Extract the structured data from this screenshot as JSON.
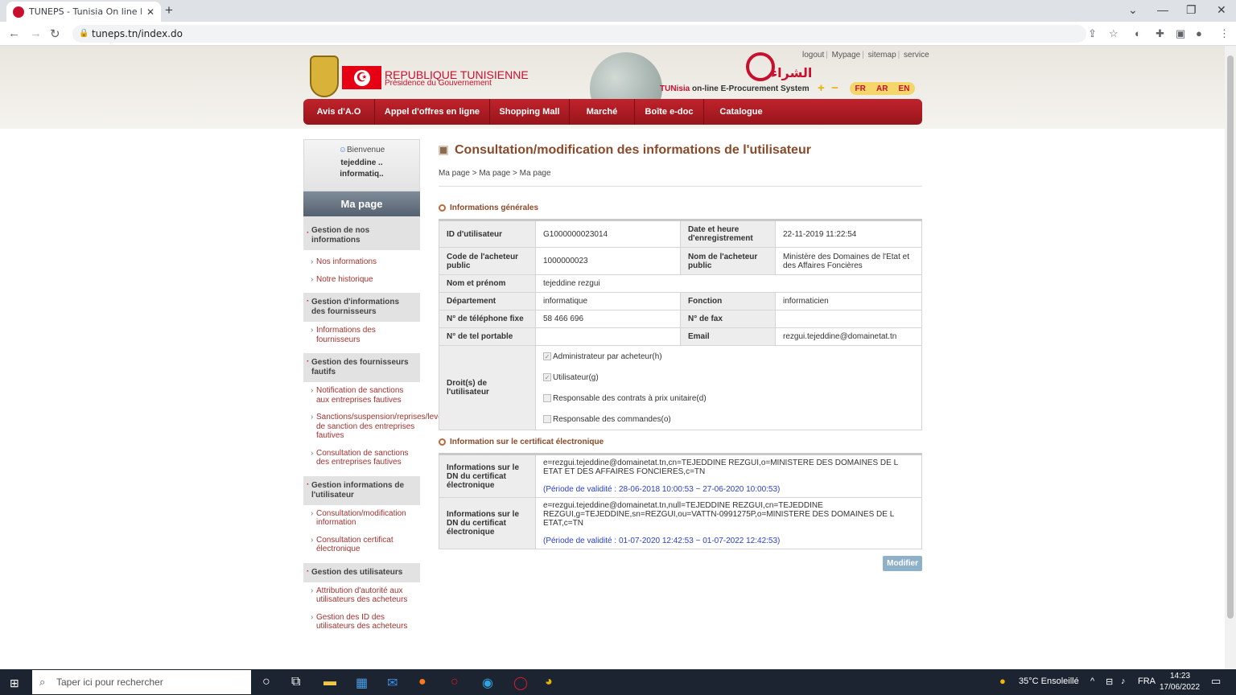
{
  "browser": {
    "tab_title": "TUNEPS - Tunisia On line E-Proc",
    "tab_close": "✕",
    "new_tab": "+",
    "url": "tuneps.tn/index.do",
    "win_min": "—",
    "win_restore": "❐",
    "win_close": "✕",
    "win_chevron": "⌄"
  },
  "header": {
    "republique": "REPUBLIQUE TUNISIENNE",
    "presidence": "Présidence du Gouvernement",
    "arabic_logo": "الشراء",
    "tagline_tun": "TUNisia",
    "tagline_rest": " on-line E-Procurement System",
    "top_links": [
      "logout",
      "Mypage",
      "sitemap",
      "service"
    ],
    "zoom_in": "+",
    "zoom_out": "−",
    "langs": [
      "FR",
      "AR",
      "EN"
    ]
  },
  "nav": [
    "Avis d'A.O",
    "Appel d'offres en ligne",
    "Shopping Mall",
    "Marché",
    "Boîte e-doc",
    "Catalogue"
  ],
  "sidebar": {
    "welcome": "Bienvenue",
    "user_line1": "tejeddine ..",
    "user_line2": "informatiq..",
    "my_page": "Ma page",
    "groups": [
      {
        "title": "Gestion de nos informations",
        "items": [
          "Nos informations",
          "Notre historique"
        ]
      },
      {
        "title": "Gestion d'informations des fournisseurs",
        "items": [
          "Informations des fournisseurs"
        ]
      },
      {
        "title": "Gestion des fournisseurs fautifs",
        "items": [
          "Notification de sanctions aux entreprises fautives",
          "Sanctions/suspension/reprises/levées de sanction des entreprises fautives",
          "Consultation de sanctions des entreprises fautives"
        ]
      },
      {
        "title": "Gestion informations de l'utilisateur",
        "items": [
          "Consultation/modification information",
          "Consultation certificat électronique"
        ]
      },
      {
        "title": "Gestion des utilisateurs",
        "items": [
          "Attribution d'autorité aux utilisateurs des acheteurs",
          "Gestion des ID des utilisateurs des acheteurs"
        ]
      }
    ]
  },
  "main": {
    "title": "Consultation/modification des informations de l'utilisateur",
    "breadcrumb": "Ma page > Ma page > Ma page",
    "section_general": "Informations générales",
    "labels": {
      "user_id": "ID d'utilisateur",
      "reg_date": "Date et heure d'enregistrement",
      "buyer_code": "Code de l'acheteur public",
      "buyer_name": "Nom de l'acheteur public",
      "full_name": "Nom et prénom",
      "department": "Département",
      "function": "Fonction",
      "phone": "N° de téléphone fixe",
      "fax": "N° de fax",
      "mobile": "N° de tel portable",
      "email": "Email",
      "rights": "Droit(s) de l'utilisateur"
    },
    "values": {
      "user_id": "G1000000023014",
      "reg_date": "22-11-2019 11:22:54",
      "buyer_code": "1000000023",
      "buyer_name": "Ministère des Domaines de l'Etat et des Affaires Foncières",
      "full_name": "tejeddine rezgui",
      "department": "informatique",
      "function": "informaticien",
      "phone": "58 466 696",
      "fax": "",
      "mobile": "",
      "email": "rezgui.tejeddine@domainetat.tn"
    },
    "rights": [
      {
        "label": "Administrateur par acheteur(h)",
        "checked": true
      },
      {
        "label": "Utilisateur(g)",
        "checked": true
      },
      {
        "label": "Responsable des contrats à prix unitaire(d)",
        "checked": false
      },
      {
        "label": "Responsable des commandes(o)",
        "checked": false
      }
    ],
    "section_cert": "Information sur le certificat électronique",
    "cert_label": "Informations sur le DN du certificat électronique",
    "certs": [
      {
        "dn": "e=rezgui.tejeddine@domainetat.tn,cn=TEJEDDINE REZGUI,o=MINISTERE DES DOMAINES DE L ETAT ET DES AFFAIRES FONCIERES,c=TN",
        "validity": "(Période de validité : 28-06-2018 10:00:53 ~ 27-06-2020 10:00:53)"
      },
      {
        "dn": "e=rezgui.tejeddine@domainetat.tn,null=TEJEDDINE REZGUI,cn=TEJEDDINE REZGUI,g=TEJEDDINE,sn=REZGUI,ou=VATTN-0991275P,o=MINISTERE DES DOMAINES DE L ETAT,c=TN",
        "validity": "(Période de validité : 01-07-2020 12:42:53 ~ 01-07-2022 12:42:53)"
      }
    ],
    "modify_button": "Modifier"
  },
  "taskbar": {
    "search_placeholder": "Taper ici pour rechercher",
    "weather": "35°C Ensoleillé",
    "lang": "FRA",
    "time": "14:23",
    "date": "17/06/2022"
  }
}
